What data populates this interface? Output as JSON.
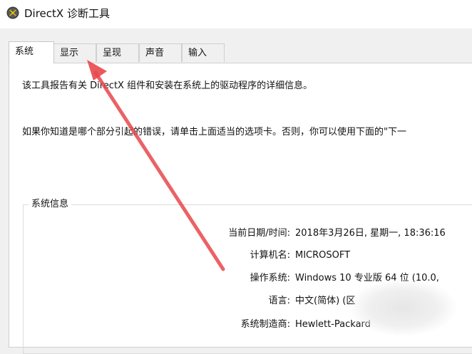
{
  "window": {
    "title": "DirectX 诊断工具",
    "icon": "directx-x-icon"
  },
  "tabs": [
    {
      "label": "系统",
      "active": true
    },
    {
      "label": "显示",
      "active": false
    },
    {
      "label": "呈现",
      "active": false
    },
    {
      "label": "声音",
      "active": false
    },
    {
      "label": "输入",
      "active": false
    }
  ],
  "intro": {
    "line1": "该工具报告有关 DirectX 组件和安装在系统上的驱动程序的详细信息。",
    "line2": "如果你知道是哪个部分引起的错误，请单击上面适当的选项卡。否则，你可以使用下面的\"下一"
  },
  "system_info": {
    "title": "系统信息",
    "rows": [
      {
        "label": "当前日期/时间:",
        "value": "2018年3月26日, 星期一, 18:36:16"
      },
      {
        "label": "计算机名:",
        "value": "MICROSOFT"
      },
      {
        "label": "操作系统:",
        "value": "Windows 10 专业版 64 位 (10.0,"
      },
      {
        "label": "语言:",
        "value": "中文(简体) (区"
      },
      {
        "label": "系统制造商:",
        "value": "Hewlett-Packard"
      }
    ]
  },
  "annotation": {
    "arrow_color": "#e8474c"
  }
}
